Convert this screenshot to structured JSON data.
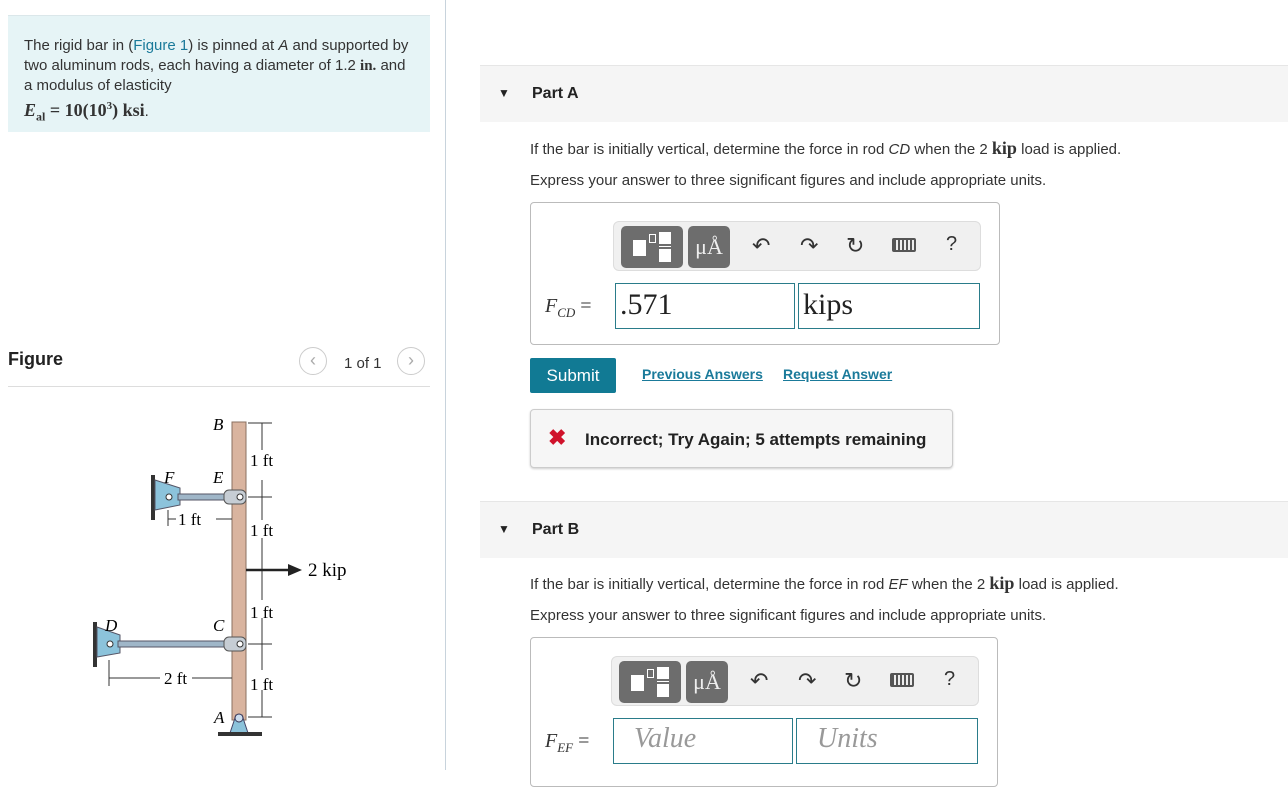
{
  "intro": {
    "t1": "The rigid bar in (",
    "link": "Figure 1",
    "t2": ") is pinned at ",
    "A": "A",
    "t3": " and supported by two aluminum rods, each having a diameter of ",
    "dia": "1.2",
    "in": "in.",
    "t4": " and a modulus of elasticity ",
    "E": "E",
    "Esub": "al",
    "Eval": " = 10(10",
    "Eexp": "3",
    "Eunit": ") ksi",
    "end": "."
  },
  "figure": {
    "title": "Figure",
    "pager": "1 of 1",
    "labels": {
      "B": "B",
      "E": "E",
      "F": "F",
      "C": "C",
      "D": "D",
      "A": "A",
      "load": "2 kip",
      "ft1": "1 ft",
      "ft2": "2 ft"
    }
  },
  "partA": {
    "label": "Part A",
    "q1": "If the bar is initially vertical, determine the force in rod ",
    "rod": "CD",
    "q2": " when the 2 ",
    "kip": "kip",
    "q3": " load is applied.",
    "instr": "Express your answer to three significant figures and include appropriate units.",
    "lhs": "F",
    "lhs_sub": "CD",
    "eq": " =",
    "value": ".571",
    "units": "kips",
    "submit": "Submit",
    "prev": "Previous Answers",
    "request": "Request Answer",
    "feedback": "Incorrect; Try Again; 5 attempts remaining"
  },
  "partB": {
    "label": "Part B",
    "q1": "If the bar is initially vertical, determine the force in rod ",
    "rod": "EF",
    "q2": " when the 2 ",
    "kip": "kip",
    "q3": " load is applied.",
    "instr": "Express your answer to three significant figures and include appropriate units.",
    "lhs": "F",
    "lhs_sub": "EF",
    "eq": " =",
    "value_placeholder": "Value",
    "units_placeholder": "Units"
  },
  "toolbar": {
    "units_btn": "μÅ",
    "help": "?"
  },
  "colors": {
    "accent": "#117a94",
    "error": "#d0122b",
    "intro_bg": "#e6f4f6"
  }
}
